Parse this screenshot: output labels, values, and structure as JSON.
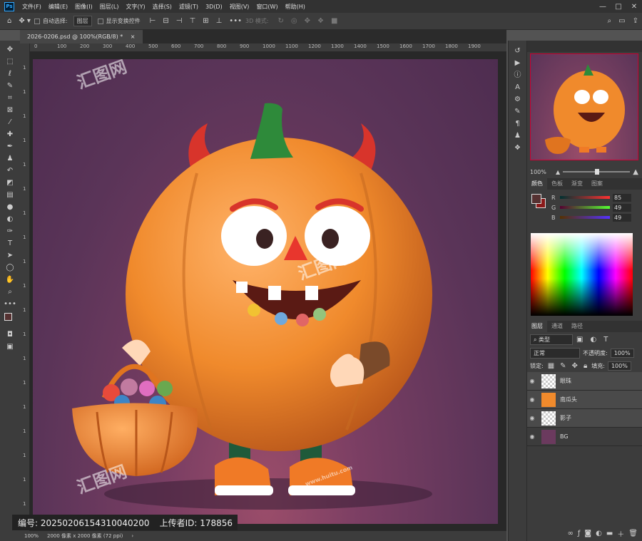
{
  "app": {
    "logo": "Ps"
  },
  "menu": [
    "文件(F)",
    "编辑(E)",
    "图像(I)",
    "图层(L)",
    "文字(Y)",
    "选择(S)",
    "滤镜(T)",
    "3D(D)",
    "视图(V)",
    "窗口(W)",
    "帮助(H)"
  ],
  "window_controls": [
    "—",
    "□",
    "✕"
  ],
  "options": {
    "auto_select_label": "自动选择:",
    "auto_select_value": "图层",
    "show_transform_label": "显示变换控件",
    "mode_3d_label": "3D 模式:",
    "more": "•••"
  },
  "document": {
    "tab_title": "2026-0206.psd @ 100%(RGB/8) *",
    "tab_close": "×",
    "ruler_h": [
      "0",
      "100",
      "200",
      "300",
      "400",
      "500",
      "600",
      "700",
      "800",
      "900",
      "1000",
      "1100",
      "1200",
      "1300",
      "1400",
      "1500",
      "1600",
      "1700",
      "1800",
      "1900"
    ],
    "ruler_v": [
      "1",
      "1",
      "1",
      "1",
      "1",
      "1",
      "1",
      "1",
      "1",
      "1",
      "1",
      "1",
      "1",
      "1",
      "1",
      "1",
      "1",
      "1",
      "1",
      "1"
    ]
  },
  "status": {
    "zoom": "100%",
    "size": "2000 像素 x 2000 像素 (72 ppi)",
    "arrow": "›"
  },
  "banner": {
    "id_label": "编号:",
    "id_value": "20250206154310040200",
    "uploader_label": "上传者ID:",
    "uploader_value": "178856"
  },
  "navigator": {
    "zoom": "100%"
  },
  "color_panel": {
    "tabs": [
      "颜色",
      "色板",
      "渐变",
      "图案"
    ],
    "r_label": "R",
    "r_value": "85",
    "g_label": "G",
    "g_value": "49",
    "b_label": "B",
    "b_value": "49",
    "fg_color": "#553131",
    "bg_color": "#8a1a1a"
  },
  "layers_panel": {
    "tabs": [
      "图层",
      "通道",
      "路径"
    ],
    "filter_value": "类型",
    "blend_mode": "正常",
    "opacity_label": "不透明度:",
    "opacity_value": "100%",
    "lock_label": "锁定:",
    "fill_label": "填充:",
    "fill_value": "100%",
    "layers": [
      {
        "name": "眼珠"
      },
      {
        "name": "南瓜头"
      },
      {
        "name": "影子"
      },
      {
        "name": "BG"
      }
    ]
  },
  "watermark": {
    "brand": "汇图网",
    "url": "www.huitu.com"
  },
  "colors": {
    "accent": "#31a8ff",
    "pumpkin": "#f08a2c",
    "bg_canvas": "#6b3a5e"
  }
}
